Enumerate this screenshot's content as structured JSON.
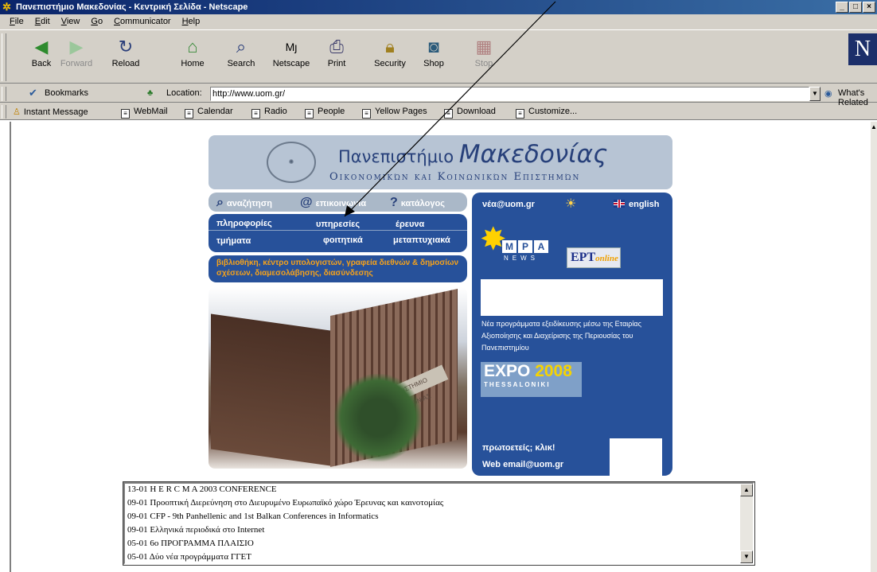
{
  "window": {
    "title": "Πανεπιστήμιο Μακεδονίας - Κεντρική Σελίδα - Netscape",
    "controls": [
      "_",
      "□",
      "×"
    ]
  },
  "menu": [
    "File",
    "Edit",
    "View",
    "Go",
    "Communicator",
    "Help"
  ],
  "toolbar": {
    "back": "Back",
    "forward": "Forward",
    "reload": "Reload",
    "home": "Home",
    "search": "Search",
    "netscape": "Netscape",
    "print": "Print",
    "security": "Security",
    "shop": "Shop",
    "stop": "Stop"
  },
  "location": {
    "bookmarks": "Bookmarks",
    "label": "Location:",
    "url": "http://www.uom.gr/",
    "related": "What's Related"
  },
  "personal": {
    "instant_message": "Instant Message",
    "items": [
      "WebMail",
      "Calendar",
      "Radio",
      "People",
      "Yellow Pages",
      "Download",
      "Customize..."
    ]
  },
  "page": {
    "banner": {
      "title_prefix": "Πανεπιστήμιο ",
      "title_main": "Μακεδονίας",
      "subtitle": "Οικονομικών και Κοινωνικών Επιστημών"
    },
    "utility": {
      "search": "αναζήτηση",
      "contact": "επικοινωνία",
      "catalog": "κατάλογος"
    },
    "nav": {
      "info": "πληροφορίες",
      "services": "υπηρεσίες",
      "research": "έρευνα",
      "departments": "τμήματα",
      "students": "φοιτητικά",
      "postgrad": "μεταπτυχιακά"
    },
    "services_text": "βιβλιοθήκη, κέντρο υπολογιστών, γραφεία διεθνών & δημοσίων σχέσεων, διαμεσολάβησης, διασύνδεσης",
    "photo_sign": "ΠΑΝΕΠΙΣΤΗΜΙΟ ΜΑΚΕΔΟΝΙΑΣ",
    "right": {
      "news": "νέα@uom.gr",
      "english": "english",
      "mpa_letters": [
        "M",
        "P",
        "A"
      ],
      "mpa_news": "NEWS",
      "ert": "EPT",
      "ert_script": "online",
      "blurb": "Νέα προγράμματα εξειδίκευσης μέσω της Εταιρίας Αξιοποίησης και Διαχείρισης της Περιουσίας του Πανεπιστημίου",
      "expo_word": "EXPO ",
      "expo_year": "2008",
      "expo_city": "THESSALONIKI",
      "freshmen": "πρωτοετείς; κλικ!",
      "webmail": "Web email@uom.gr"
    },
    "news_list": [
      "13-01 H E R C M A 2003 CONFERENCE",
      "09-01 Προοπτική Διερεύνηση στο Διευρυμένο Ευρωπαϊκό χώρο Έρευνας και καινοτομίας",
      "09-01 CFP - 9th Panhellenic and 1st Balkan Conferences in Informatics",
      "09-01 Ελληνικά περιοδικά στο Internet",
      "05-01 6ο ΠΡΟΓΡΑΜΜΑ ΠΛΑΙΣΙΟ",
      "05-01 Δύο νέα προγράμματα ΓΓΕΤ"
    ]
  },
  "colors": {
    "nav_blue": "#27519a",
    "banner": "#b7c4d4",
    "orange": "#f6a21a",
    "titlebar": "#0a246a"
  }
}
